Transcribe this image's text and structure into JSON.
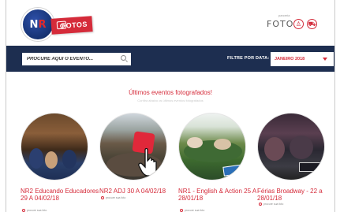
{
  "header": {
    "logo_n": "N",
    "logo_r": "R",
    "fotos_label": "FOTOS",
    "partner_sup": "parceria",
    "partner_name": "FOTOP",
    "user_icon": "user-icon",
    "cart_icon": "cart-icon"
  },
  "search": {
    "placeholder": "PROCURE AQUI O EVENTO...",
    "filter_label": "FILTRE POR DATA:",
    "filter_value": "JANEIRO 2018"
  },
  "section": {
    "title": "Últimos eventos fotografados!",
    "subtitle": "Confira abaixo os últimos eventos fotografados"
  },
  "events": [
    {
      "title": "NR2 Educando Educadores 29 A 04/02/18",
      "meta": "procure sua foto"
    },
    {
      "title": "NR2 ADJ 30 A 04/02/18",
      "meta": "procure sua foto"
    },
    {
      "title": "NR1 - English & Action 25 A 28/01/18",
      "meta": "procure sua foto"
    },
    {
      "title": "Férias Broadway - 22 a 28/01/18",
      "meta": "procure sua foto"
    }
  ],
  "colors": {
    "brand_red": "#d52b3a",
    "nav_blue": "#1d2e50"
  }
}
